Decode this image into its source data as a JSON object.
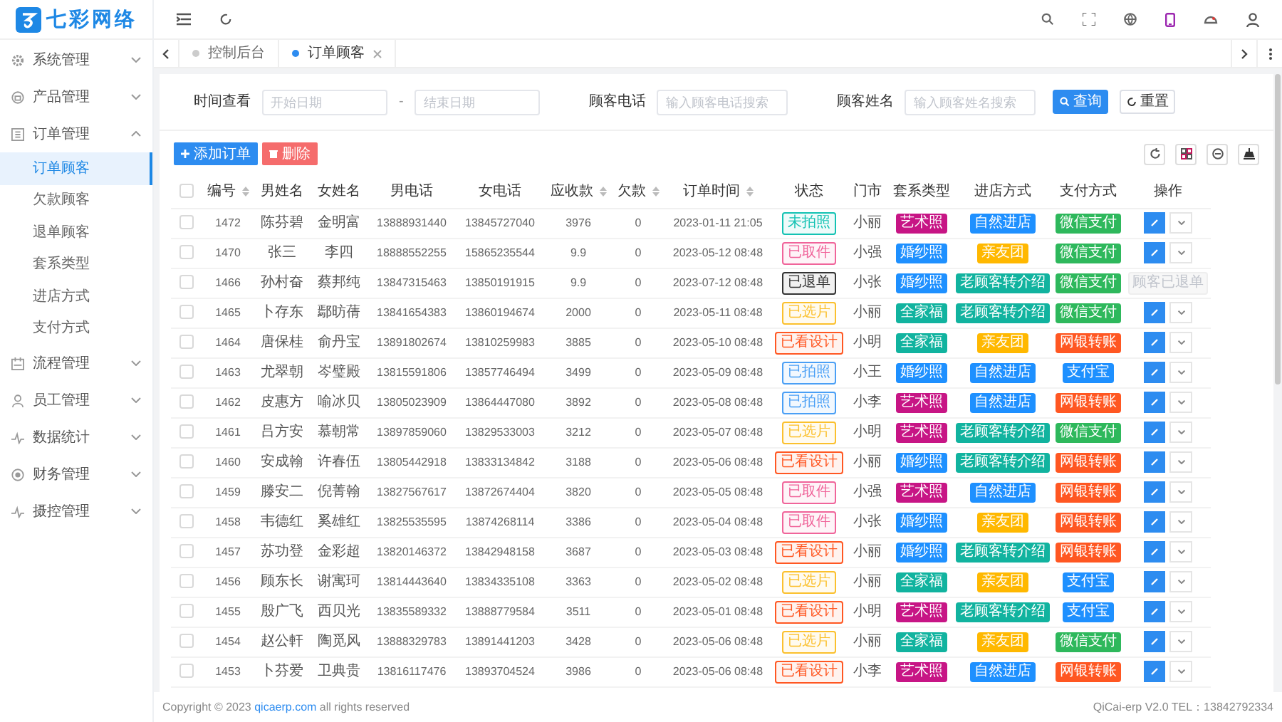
{
  "logo": {
    "text": "七彩网络"
  },
  "sidebar": {
    "items": [
      {
        "label": "系统管理",
        "expanded": false
      },
      {
        "label": "产品管理",
        "expanded": false
      },
      {
        "label": "订单管理",
        "expanded": true,
        "children": [
          {
            "label": "订单顾客",
            "selected": true
          },
          {
            "label": "欠款顾客",
            "selected": false
          },
          {
            "label": "退单顾客",
            "selected": false
          },
          {
            "label": "套系类型",
            "selected": false
          },
          {
            "label": "进店方式",
            "selected": false
          },
          {
            "label": "支付方式",
            "selected": false
          }
        ]
      },
      {
        "label": "流程管理",
        "expanded": false
      },
      {
        "label": "员工管理",
        "expanded": false
      },
      {
        "label": "数据统计",
        "expanded": false
      },
      {
        "label": "财务管理",
        "expanded": false
      },
      {
        "label": "摄控管理",
        "expanded": false
      }
    ]
  },
  "tabs": [
    {
      "label": "控制后台",
      "selected": false,
      "closable": false
    },
    {
      "label": "订单顾客",
      "selected": true,
      "closable": true
    }
  ],
  "filters": {
    "date_label": "时间查看",
    "start_placeholder": "开始日期",
    "separator": "-",
    "end_placeholder": "结束日期",
    "phone_label": "顾客电话",
    "phone_placeholder": "输入顾客电话搜索",
    "name_label": "顾客姓名",
    "name_placeholder": "输入顾客姓名搜索",
    "search_button": "查询",
    "reset_button": "重置"
  },
  "toolbar": {
    "add_button": "添加订单",
    "delete_button": "删除"
  },
  "table": {
    "select_all": {
      "checked": false
    },
    "columns": [
      {
        "label": "编号",
        "sortable": true
      },
      {
        "label": "男姓名",
        "sortable": false
      },
      {
        "label": "女姓名",
        "sortable": false
      },
      {
        "label": "男电话",
        "sortable": false
      },
      {
        "label": "女电话",
        "sortable": false
      },
      {
        "label": "应收款",
        "sortable": true
      },
      {
        "label": "欠款",
        "sortable": true
      },
      {
        "label": "订单时间",
        "sortable": true
      },
      {
        "label": "状态",
        "sortable": false
      },
      {
        "label": "门市",
        "sortable": false
      },
      {
        "label": "套系类型",
        "sortable": false
      },
      {
        "label": "进店方式",
        "sortable": false
      },
      {
        "label": "支付方式",
        "sortable": false
      },
      {
        "label": "操作",
        "sortable": false
      }
    ],
    "rows": [
      {
        "checked": false,
        "id": "1472",
        "male": "陈芬碧",
        "female": "金明富",
        "male_phone": "13888931440",
        "female_phone": "13845727040",
        "receivable": "3976",
        "debt": "0",
        "time": "2023-01-11 21:05",
        "status": {
          "text": "未拍照",
          "color": "#13c2b3"
        },
        "store": "小丽",
        "package": {
          "text": "艺术照",
          "color": "#c71585"
        },
        "entry": {
          "text": "自然进店",
          "color": "#1e90ff"
        },
        "payment": {
          "text": "微信支付",
          "color": "#2eb85c"
        },
        "action": {
          "kind": "edit"
        }
      },
      {
        "checked": false,
        "id": "1470",
        "male": "张三",
        "female": "李四",
        "male_phone": "18888552255",
        "female_phone": "15865235544",
        "receivable": "9.9",
        "debt": "0",
        "time": "2023-05-12 08:48",
        "status": {
          "text": "已取件",
          "color": "#f0649a"
        },
        "store": "小强",
        "package": {
          "text": "婚纱照",
          "color": "#1e90ff"
        },
        "entry": {
          "text": "亲友团",
          "color": "#ffb800"
        },
        "payment": {
          "text": "微信支付",
          "color": "#2eb85c"
        },
        "action": {
          "kind": "edit"
        }
      },
      {
        "checked": false,
        "id": "1466",
        "male": "孙村奋",
        "female": "蔡邦纯",
        "male_phone": "13847315463",
        "female_phone": "13850191915",
        "receivable": "9.9",
        "debt": "0",
        "time": "2023-07-12 08:48",
        "status": {
          "text": "已退单",
          "color": "#333333"
        },
        "store": "小张",
        "package": {
          "text": "婚纱照",
          "color": "#1e90ff"
        },
        "entry": {
          "text": "老顾客转介绍",
          "color": "#11b39f"
        },
        "payment": {
          "text": "微信支付",
          "color": "#2eb85c"
        },
        "action": {
          "kind": "note",
          "text": "顾客已退单"
        }
      },
      {
        "checked": false,
        "id": "1465",
        "male": "卜存东",
        "female": "鄢昉蒨",
        "male_phone": "13841654383",
        "female_phone": "13860194674",
        "receivable": "2000",
        "debt": "0",
        "time": "2023-05-11 08:48",
        "status": {
          "text": "已选片",
          "color": "#fbc02d"
        },
        "store": "小丽",
        "package": {
          "text": "全家福",
          "color": "#11b39f"
        },
        "entry": {
          "text": "老顾客转介绍",
          "color": "#11b39f"
        },
        "payment": {
          "text": "微信支付",
          "color": "#2eb85c"
        },
        "action": {
          "kind": "edit"
        }
      },
      {
        "checked": false,
        "id": "1464",
        "male": "唐保桂",
        "female": "俞丹宝",
        "male_phone": "13891802674",
        "female_phone": "13810259983",
        "receivable": "3885",
        "debt": "0",
        "time": "2023-05-10 08:48",
        "status": {
          "text": "已看设计",
          "color": "#ff5722"
        },
        "store": "小明",
        "package": {
          "text": "全家福",
          "color": "#11b39f"
        },
        "entry": {
          "text": "亲友团",
          "color": "#ffb800"
        },
        "payment": {
          "text": "网银转账",
          "color": "#ff5722"
        },
        "action": {
          "kind": "edit"
        }
      },
      {
        "checked": false,
        "id": "1463",
        "male": "尤翠朝",
        "female": "岑璧殿",
        "male_phone": "13815591806",
        "female_phone": "13857746494",
        "receivable": "3499",
        "debt": "0",
        "time": "2023-05-09 08:48",
        "status": {
          "text": "已拍照",
          "color": "#4a9ff5"
        },
        "store": "小王",
        "package": {
          "text": "婚纱照",
          "color": "#1e90ff"
        },
        "entry": {
          "text": "自然进店",
          "color": "#1e90ff"
        },
        "payment": {
          "text": "支付宝",
          "color": "#1e90ff"
        },
        "action": {
          "kind": "edit"
        }
      },
      {
        "checked": false,
        "id": "1462",
        "male": "皮惠方",
        "female": "喻冰贝",
        "male_phone": "13805023909",
        "female_phone": "13864447080",
        "receivable": "3892",
        "debt": "0",
        "time": "2023-05-08 08:48",
        "status": {
          "text": "已拍照",
          "color": "#4a9ff5"
        },
        "store": "小李",
        "package": {
          "text": "艺术照",
          "color": "#c71585"
        },
        "entry": {
          "text": "自然进店",
          "color": "#1e90ff"
        },
        "payment": {
          "text": "网银转账",
          "color": "#ff5722"
        },
        "action": {
          "kind": "edit"
        }
      },
      {
        "checked": false,
        "id": "1461",
        "male": "吕方安",
        "female": "慕朝常",
        "male_phone": "13897859060",
        "female_phone": "13829533003",
        "receivable": "3212",
        "debt": "0",
        "time": "2023-05-07 08:48",
        "status": {
          "text": "已选片",
          "color": "#fbc02d"
        },
        "store": "小明",
        "package": {
          "text": "艺术照",
          "color": "#c71585"
        },
        "entry": {
          "text": "老顾客转介绍",
          "color": "#11b39f"
        },
        "payment": {
          "text": "微信支付",
          "color": "#2eb85c"
        },
        "action": {
          "kind": "edit"
        }
      },
      {
        "checked": false,
        "id": "1460",
        "male": "安成翰",
        "female": "许春伍",
        "male_phone": "13805442918",
        "female_phone": "13833134842",
        "receivable": "3188",
        "debt": "0",
        "time": "2023-05-06 08:48",
        "status": {
          "text": "已看设计",
          "color": "#ff5722"
        },
        "store": "小丽",
        "package": {
          "text": "婚纱照",
          "color": "#1e90ff"
        },
        "entry": {
          "text": "老顾客转介绍",
          "color": "#11b39f"
        },
        "payment": {
          "text": "网银转账",
          "color": "#ff5722"
        },
        "action": {
          "kind": "edit"
        }
      },
      {
        "checked": false,
        "id": "1459",
        "male": "滕安二",
        "female": "倪菁翰",
        "male_phone": "13827567617",
        "female_phone": "13872674404",
        "receivable": "3820",
        "debt": "0",
        "time": "2023-05-05 08:48",
        "status": {
          "text": "已取件",
          "color": "#f0649a"
        },
        "store": "小强",
        "package": {
          "text": "艺术照",
          "color": "#c71585"
        },
        "entry": {
          "text": "自然进店",
          "color": "#1e90ff"
        },
        "payment": {
          "text": "网银转账",
          "color": "#ff5722"
        },
        "action": {
          "kind": "edit"
        }
      },
      {
        "checked": false,
        "id": "1458",
        "male": "韦德红",
        "female": "奚雄红",
        "male_phone": "13825535595",
        "female_phone": "13874268114",
        "receivable": "3386",
        "debt": "0",
        "time": "2023-05-04 08:48",
        "status": {
          "text": "已取件",
          "color": "#f0649a"
        },
        "store": "小张",
        "package": {
          "text": "婚纱照",
          "color": "#1e90ff"
        },
        "entry": {
          "text": "亲友团",
          "color": "#ffb800"
        },
        "payment": {
          "text": "网银转账",
          "color": "#ff5722"
        },
        "action": {
          "kind": "edit"
        }
      },
      {
        "checked": false,
        "id": "1457",
        "male": "苏功登",
        "female": "金彩超",
        "male_phone": "13820146372",
        "female_phone": "13842948158",
        "receivable": "3687",
        "debt": "0",
        "time": "2023-05-03 08:48",
        "status": {
          "text": "已看设计",
          "color": "#ff5722"
        },
        "store": "小丽",
        "package": {
          "text": "婚纱照",
          "color": "#1e90ff"
        },
        "entry": {
          "text": "老顾客转介绍",
          "color": "#11b39f"
        },
        "payment": {
          "text": "网银转账",
          "color": "#ff5722"
        },
        "action": {
          "kind": "edit"
        }
      },
      {
        "checked": false,
        "id": "1456",
        "male": "顾东长",
        "female": "谢寓珂",
        "male_phone": "13814443640",
        "female_phone": "13834335108",
        "receivable": "3363",
        "debt": "0",
        "time": "2023-05-02 08:48",
        "status": {
          "text": "已选片",
          "color": "#fbc02d"
        },
        "store": "小丽",
        "package": {
          "text": "全家福",
          "color": "#11b39f"
        },
        "entry": {
          "text": "亲友团",
          "color": "#ffb800"
        },
        "payment": {
          "text": "支付宝",
          "color": "#1e90ff"
        },
        "action": {
          "kind": "edit"
        }
      },
      {
        "checked": false,
        "id": "1455",
        "male": "殷广飞",
        "female": "西贝光",
        "male_phone": "13835589332",
        "female_phone": "13888779584",
        "receivable": "3511",
        "debt": "0",
        "time": "2023-05-01 08:48",
        "status": {
          "text": "已看设计",
          "color": "#ff5722"
        },
        "store": "小明",
        "package": {
          "text": "艺术照",
          "color": "#c71585"
        },
        "entry": {
          "text": "老顾客转介绍",
          "color": "#11b39f"
        },
        "payment": {
          "text": "支付宝",
          "color": "#1e90ff"
        },
        "action": {
          "kind": "edit"
        }
      },
      {
        "checked": false,
        "id": "1454",
        "male": "赵公軒",
        "female": "陶觅风",
        "male_phone": "13888329783",
        "female_phone": "13891441203",
        "receivable": "3428",
        "debt": "0",
        "time": "2023-05-06 08:48",
        "status": {
          "text": "已选片",
          "color": "#fbc02d"
        },
        "store": "小丽",
        "package": {
          "text": "全家福",
          "color": "#11b39f"
        },
        "entry": {
          "text": "亲友团",
          "color": "#ffb800"
        },
        "payment": {
          "text": "微信支付",
          "color": "#2eb85c"
        },
        "action": {
          "kind": "edit"
        }
      },
      {
        "checked": false,
        "id": "1453",
        "male": "卜芬爱",
        "female": "卫典贵",
        "male_phone": "13816117476",
        "female_phone": "13893704524",
        "receivable": "3986",
        "debt": "0",
        "time": "2023-05-06 08:48",
        "status": {
          "text": "已看设计",
          "color": "#ff5722"
        },
        "store": "小李",
        "package": {
          "text": "艺术照",
          "color": "#c71585"
        },
        "entry": {
          "text": "自然进店",
          "color": "#1e90ff"
        },
        "payment": {
          "text": "网银转账",
          "color": "#ff5722"
        },
        "action": {
          "kind": "edit"
        }
      }
    ]
  },
  "footer": {
    "copyright_before": "Copyright © 2023",
    "link": "qicaerp.com",
    "copyright_after": "all rights reserved",
    "version": "QiCai-erp V2.0 TEL：13842792334"
  }
}
